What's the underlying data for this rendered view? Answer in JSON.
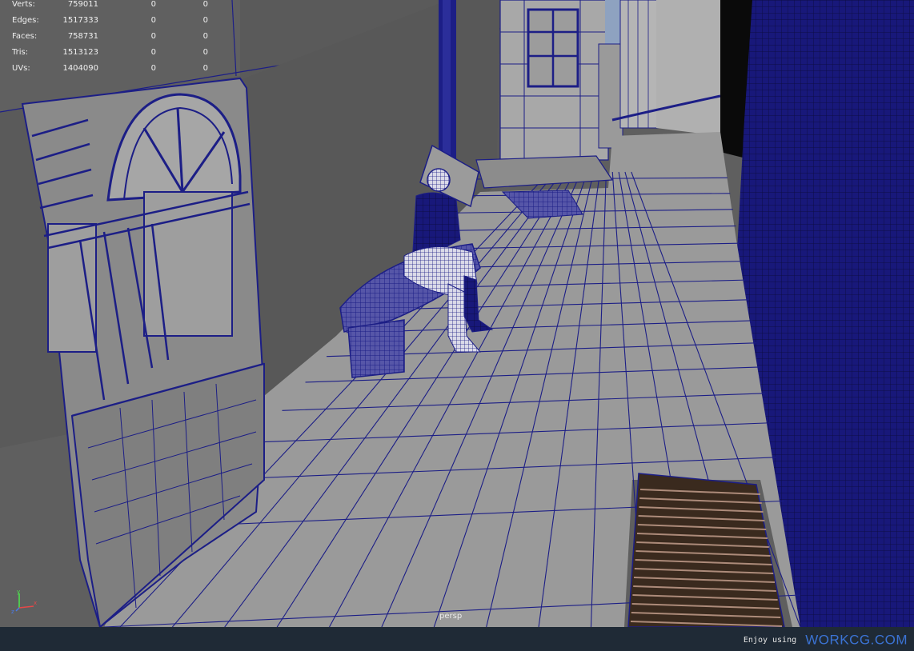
{
  "viewport": {
    "camera_label": "persp",
    "stats": [
      {
        "label": "Verts:",
        "total": "759011",
        "selected": "0",
        "component": "0"
      },
      {
        "label": "Edges:",
        "total": "1517333",
        "selected": "0",
        "component": "0"
      },
      {
        "label": "Faces:",
        "total": "758731",
        "selected": "0",
        "component": "0"
      },
      {
        "label": "Tris:",
        "total": "1513123",
        "selected": "0",
        "component": "0"
      },
      {
        "label": "UVs:",
        "total": "1404090",
        "selected": "0",
        "component": "0"
      }
    ],
    "axis_icon": "xyz-axis-gizmo-icon"
  },
  "footer": {
    "enjoy_text": "Enjoy using",
    "brand_text": "WORKCG.COM"
  },
  "colors": {
    "wire": "#1c1e86",
    "viewport_bg": "#5f5f5f",
    "footer_bg": "#1f2a36",
    "brand": "#3b73d4"
  }
}
